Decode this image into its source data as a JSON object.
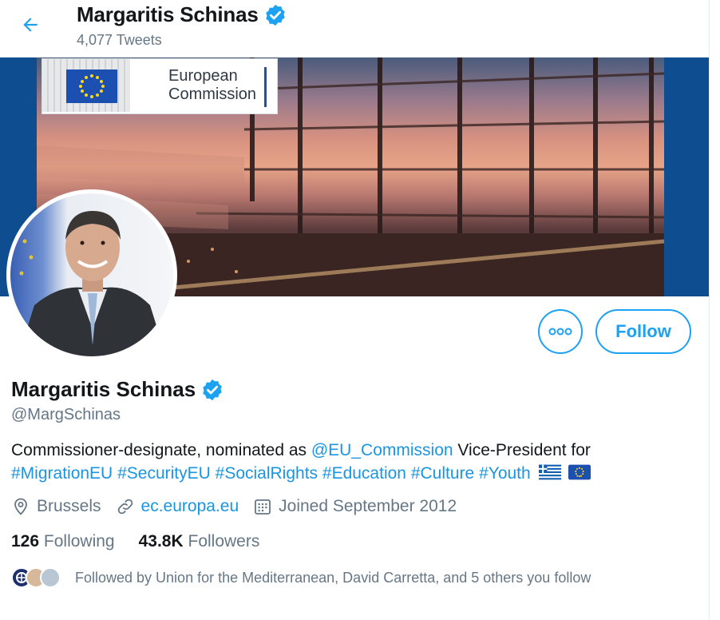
{
  "header": {
    "name": "Margaritis Schinas",
    "tweet_count": "4,077 Tweets"
  },
  "banner": {
    "logo_text_line1": "European",
    "logo_text_line2": "Commission"
  },
  "actions": {
    "follow_label": "Follow"
  },
  "profile": {
    "display_name": "Margaritis Schinas",
    "handle": "@MargSchinas",
    "bio_text_1": "Commissioner-designate, nominated as ",
    "bio_mention": "@EU_Commission",
    "bio_text_2": " Vice-President for",
    "hashtags": [
      "#MigrationEU",
      "#SecurityEU",
      "#SocialRights",
      "#Education",
      "#Culture",
      "#Youth"
    ],
    "location": "Brussels",
    "website": "ec.europa.eu",
    "joined": "Joined September 2012"
  },
  "stats": {
    "following_count": "126",
    "following_label": "Following",
    "followers_count": "43.8K",
    "followers_label": "Followers"
  },
  "followed_by": "Followed by Union for the Mediterranean, David Carretta, and 5 others you follow",
  "colors": {
    "accent": "#1da1f2",
    "link": "#1b95e0",
    "secondary_text": "#657786",
    "banner_blue": "#0e4d8f"
  },
  "icons": [
    "back-arrow-icon",
    "verified-badge-icon",
    "more-icon",
    "location-icon",
    "link-icon",
    "calendar-icon",
    "greece-flag-icon",
    "eu-flag-icon"
  ]
}
